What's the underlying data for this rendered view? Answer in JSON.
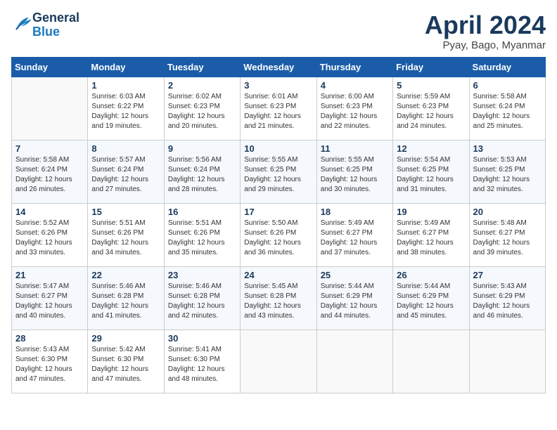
{
  "header": {
    "logo_line1": "General",
    "logo_line2": "Blue",
    "month": "April 2024",
    "location": "Pyay, Bago, Myanmar"
  },
  "days_of_week": [
    "Sunday",
    "Monday",
    "Tuesday",
    "Wednesday",
    "Thursday",
    "Friday",
    "Saturday"
  ],
  "weeks": [
    [
      {
        "day": "",
        "info": ""
      },
      {
        "day": "1",
        "info": "Sunrise: 6:03 AM\nSunset: 6:22 PM\nDaylight: 12 hours\nand 19 minutes."
      },
      {
        "day": "2",
        "info": "Sunrise: 6:02 AM\nSunset: 6:23 PM\nDaylight: 12 hours\nand 20 minutes."
      },
      {
        "day": "3",
        "info": "Sunrise: 6:01 AM\nSunset: 6:23 PM\nDaylight: 12 hours\nand 21 minutes."
      },
      {
        "day": "4",
        "info": "Sunrise: 6:00 AM\nSunset: 6:23 PM\nDaylight: 12 hours\nand 22 minutes."
      },
      {
        "day": "5",
        "info": "Sunrise: 5:59 AM\nSunset: 6:23 PM\nDaylight: 12 hours\nand 24 minutes."
      },
      {
        "day": "6",
        "info": "Sunrise: 5:58 AM\nSunset: 6:24 PM\nDaylight: 12 hours\nand 25 minutes."
      }
    ],
    [
      {
        "day": "7",
        "info": "Sunrise: 5:58 AM\nSunset: 6:24 PM\nDaylight: 12 hours\nand 26 minutes."
      },
      {
        "day": "8",
        "info": "Sunrise: 5:57 AM\nSunset: 6:24 PM\nDaylight: 12 hours\nand 27 minutes."
      },
      {
        "day": "9",
        "info": "Sunrise: 5:56 AM\nSunset: 6:24 PM\nDaylight: 12 hours\nand 28 minutes."
      },
      {
        "day": "10",
        "info": "Sunrise: 5:55 AM\nSunset: 6:25 PM\nDaylight: 12 hours\nand 29 minutes."
      },
      {
        "day": "11",
        "info": "Sunrise: 5:55 AM\nSunset: 6:25 PM\nDaylight: 12 hours\nand 30 minutes."
      },
      {
        "day": "12",
        "info": "Sunrise: 5:54 AM\nSunset: 6:25 PM\nDaylight: 12 hours\nand 31 minutes."
      },
      {
        "day": "13",
        "info": "Sunrise: 5:53 AM\nSunset: 6:25 PM\nDaylight: 12 hours\nand 32 minutes."
      }
    ],
    [
      {
        "day": "14",
        "info": "Sunrise: 5:52 AM\nSunset: 6:26 PM\nDaylight: 12 hours\nand 33 minutes."
      },
      {
        "day": "15",
        "info": "Sunrise: 5:51 AM\nSunset: 6:26 PM\nDaylight: 12 hours\nand 34 minutes."
      },
      {
        "day": "16",
        "info": "Sunrise: 5:51 AM\nSunset: 6:26 PM\nDaylight: 12 hours\nand 35 minutes."
      },
      {
        "day": "17",
        "info": "Sunrise: 5:50 AM\nSunset: 6:26 PM\nDaylight: 12 hours\nand 36 minutes."
      },
      {
        "day": "18",
        "info": "Sunrise: 5:49 AM\nSunset: 6:27 PM\nDaylight: 12 hours\nand 37 minutes."
      },
      {
        "day": "19",
        "info": "Sunrise: 5:49 AM\nSunset: 6:27 PM\nDaylight: 12 hours\nand 38 minutes."
      },
      {
        "day": "20",
        "info": "Sunrise: 5:48 AM\nSunset: 6:27 PM\nDaylight: 12 hours\nand 39 minutes."
      }
    ],
    [
      {
        "day": "21",
        "info": "Sunrise: 5:47 AM\nSunset: 6:27 PM\nDaylight: 12 hours\nand 40 minutes."
      },
      {
        "day": "22",
        "info": "Sunrise: 5:46 AM\nSunset: 6:28 PM\nDaylight: 12 hours\nand 41 minutes."
      },
      {
        "day": "23",
        "info": "Sunrise: 5:46 AM\nSunset: 6:28 PM\nDaylight: 12 hours\nand 42 minutes."
      },
      {
        "day": "24",
        "info": "Sunrise: 5:45 AM\nSunset: 6:28 PM\nDaylight: 12 hours\nand 43 minutes."
      },
      {
        "day": "25",
        "info": "Sunrise: 5:44 AM\nSunset: 6:29 PM\nDaylight: 12 hours\nand 44 minutes."
      },
      {
        "day": "26",
        "info": "Sunrise: 5:44 AM\nSunset: 6:29 PM\nDaylight: 12 hours\nand 45 minutes."
      },
      {
        "day": "27",
        "info": "Sunrise: 5:43 AM\nSunset: 6:29 PM\nDaylight: 12 hours\nand 46 minutes."
      }
    ],
    [
      {
        "day": "28",
        "info": "Sunrise: 5:43 AM\nSunset: 6:30 PM\nDaylight: 12 hours\nand 47 minutes."
      },
      {
        "day": "29",
        "info": "Sunrise: 5:42 AM\nSunset: 6:30 PM\nDaylight: 12 hours\nand 47 minutes."
      },
      {
        "day": "30",
        "info": "Sunrise: 5:41 AM\nSunset: 6:30 PM\nDaylight: 12 hours\nand 48 minutes."
      },
      {
        "day": "",
        "info": ""
      },
      {
        "day": "",
        "info": ""
      },
      {
        "day": "",
        "info": ""
      },
      {
        "day": "",
        "info": ""
      }
    ]
  ]
}
